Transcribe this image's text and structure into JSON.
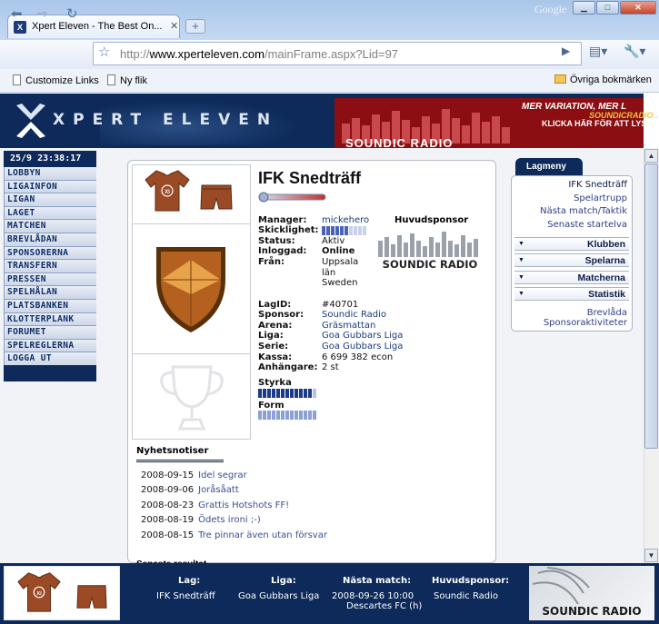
{
  "browser": {
    "tab_title": "Xpert Eleven - The Best On...",
    "google_label": "Google",
    "url_prefix": "http://",
    "url_host": "www.xperteleven.com",
    "url_path": "/mainFrame.aspx?Lid=97",
    "bookmarks": [
      "Customize Links",
      "Ny flik"
    ],
    "other_bookmarks": "Övriga bokmärken"
  },
  "header": {
    "logo_text": "XPERT ELEVEN",
    "banner_line1": "MER VARIATION, MER L",
    "banner_line2": "SOUNDICRADIO . C",
    "banner_line3": "KLICKA HÄR FÖR ATT LYS",
    "banner_brand": "SOUNDIC RADIO"
  },
  "clock": "25/9 23:38:17",
  "left_menu": [
    "LOBBYN",
    "LIGAINFON",
    "LIGAN",
    "LAGET",
    "MATCHEN",
    "BREVLÅDAN",
    "SPONSORERNA",
    "TRANSFERN",
    "PRESSEN",
    "SPELHÅLAN",
    "PLATSBANKEN",
    "KLOTTERPLANK",
    "FORUMET",
    "SPELREGLERNA",
    "LOGGA UT"
  ],
  "team": {
    "name": "IFK Snedträff",
    "manager_label": "Manager:",
    "manager": "mickehero",
    "skill_label": "Skicklighet:",
    "skill_level": 0.6,
    "status_label": "Status:",
    "status": "Aktiv",
    "logged_label": "Inloggad:",
    "logged": "Online",
    "from_label": "Från:",
    "from_line1": "Uppsala",
    "from_line2": "län",
    "from_line3": "Sweden",
    "sponsor_header": "Huvudsponsor",
    "sponsor_logo_text": "SOUNDIC RADIO",
    "lagid_label": "LagID:",
    "lagid": "#40701",
    "sponsor_label": "Sponsor:",
    "sponsor": "Soundic Radio",
    "arena_label": "Arena:",
    "arena": "Gräsmattan",
    "liga_label": "Liga:",
    "liga": "Goa Gubbars Liga",
    "serie_label": "Serie:",
    "serie": "Goa Gubbars Liga",
    "kassa_label": "Kassa:",
    "kassa": "6 699 382 econ",
    "fans_label": "Anhängare:",
    "fans": "2 st",
    "strength_label": "Styrka",
    "strength_level": 0.9,
    "form_label": "Form",
    "form_level": 1.0
  },
  "news": {
    "header": "Nyhetsnotiser",
    "items": [
      {
        "date": "2008-09-15",
        "text": "Idel segrar"
      },
      {
        "date": "2008-09-06",
        "text": "Joråsåatt"
      },
      {
        "date": "2008-08-23",
        "text": "Grattis Hotshots FF!"
      },
      {
        "date": "2008-08-19",
        "text": "Ödets ironi ;-)"
      },
      {
        "date": "2008-08-15",
        "text": "Tre pinnar även utan försvar"
      }
    ],
    "next_header": "Senaste resultat"
  },
  "lagmeny": {
    "title": "Lagmeny",
    "links": [
      "IFK Snedträff",
      "Spelartrupp",
      "Nästa match/Taktik",
      "Senaste startelva"
    ],
    "sections": [
      "Klubben",
      "Spelarna",
      "Matcherna",
      "Statistik"
    ],
    "bottom_links": [
      "Brevlåda",
      "Sponsoraktiviteter"
    ]
  },
  "footer": {
    "lag_label": "Lag:",
    "lag": "IFK Snedträff",
    "liga_label": "Liga:",
    "liga": "Goa Gubbars Liga",
    "next_label": "Nästa match:",
    "next_date": "2008-09-26 10:00",
    "next_opponent": "Descartes FC (h)",
    "sponsor_label": "Huvudsponsor:",
    "sponsor": "Soundic Radio",
    "logo_text": "SOUNDIC RADIO"
  },
  "colors": {
    "navy": "#0d2a5a",
    "shirt": "#9a4a25",
    "link": "#2d3f86",
    "banner_red": "#8a0e12"
  }
}
